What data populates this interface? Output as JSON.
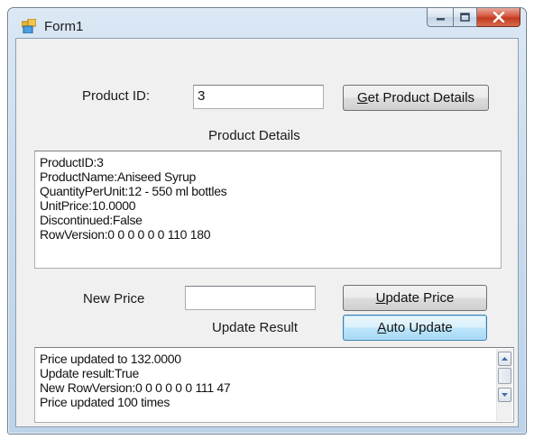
{
  "window": {
    "title": "Form1"
  },
  "form": {
    "product_id_label": "Product ID:",
    "product_id_value": "3",
    "get_details_prefix": "G",
    "get_details_rest": "et Product Details",
    "product_details_label": "Product Details",
    "details_lines": [
      "ProductID:3",
      "ProductName:Aniseed Syrup",
      "QuantityPerUnit:12 - 550 ml bottles",
      "UnitPrice:10.0000",
      "Discontinued:False",
      "RowVersion:0 0 0 0 0 0 110 180"
    ],
    "new_price_label": "New Price",
    "new_price_value": "",
    "update_price_prefix": "U",
    "update_price_rest": "pdate Price",
    "update_result_label": "Update Result",
    "auto_update_prefix": "A",
    "auto_update_rest": "uto Update",
    "result_lines": [
      "Price updated to 132.0000",
      "Update result:True",
      "New RowVersion:0 0 0 0 0 0 111 47",
      "Price updated 100 times"
    ]
  }
}
